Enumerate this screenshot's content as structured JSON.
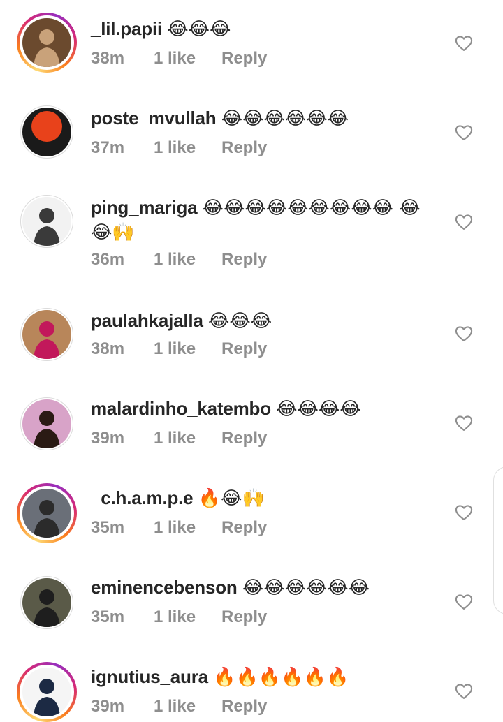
{
  "comments": [
    {
      "username": "_lil.papii",
      "text": "😂😂😂",
      "time": "38m",
      "likes": "1 like",
      "reply": "Reply",
      "story": true,
      "avatar_colors": [
        "#6b4a2e",
        "#c9a27a"
      ]
    },
    {
      "username": "poste_mvullah",
      "text": "😂😂😂😂😂😂",
      "time": "37m",
      "likes": "1 like",
      "reply": "Reply",
      "story": false,
      "avatar_colors": [
        "#1a1a1a",
        "#e8421b"
      ]
    },
    {
      "username": "ping_mariga",
      "text": "😂😂😂😂😂😂😂😂😂 😂😂🙌",
      "time": "36m",
      "likes": "1 like",
      "reply": "Reply",
      "story": false,
      "avatar_colors": [
        "#f2f2f2",
        "#3a3a3a"
      ]
    },
    {
      "username": "paulahkajalla",
      "text": "😂😂😂",
      "time": "38m",
      "likes": "1 like",
      "reply": "Reply",
      "story": false,
      "avatar_colors": [
        "#b8865a",
        "#c2185b"
      ]
    },
    {
      "username": "malardinho_katembo",
      "text": "😂😂😂😂",
      "time": "39m",
      "likes": "1 like",
      "reply": "Reply",
      "story": false,
      "avatar_colors": [
        "#d8a3c8",
        "#2a1a14"
      ]
    },
    {
      "username": "_c.h.a.m.p.e",
      "text": "🔥😂🙌",
      "time": "35m",
      "likes": "1 like",
      "reply": "Reply",
      "story": true,
      "avatar_colors": [
        "#6a6f78",
        "#2b2b2b"
      ]
    },
    {
      "username": "eminencebenson",
      "text": "😂😂😂😂😂😂",
      "time": "35m",
      "likes": "1 like",
      "reply": "Reply",
      "story": false,
      "avatar_colors": [
        "#5a5a48",
        "#1e1e1e"
      ]
    },
    {
      "username": "ignutius_aura",
      "text": "🔥🔥🔥🔥🔥🔥",
      "time": "39m",
      "likes": "1 like",
      "reply": "Reply",
      "story": true,
      "avatar_colors": [
        "#f5f5f5",
        "#1c2a44"
      ]
    }
  ]
}
